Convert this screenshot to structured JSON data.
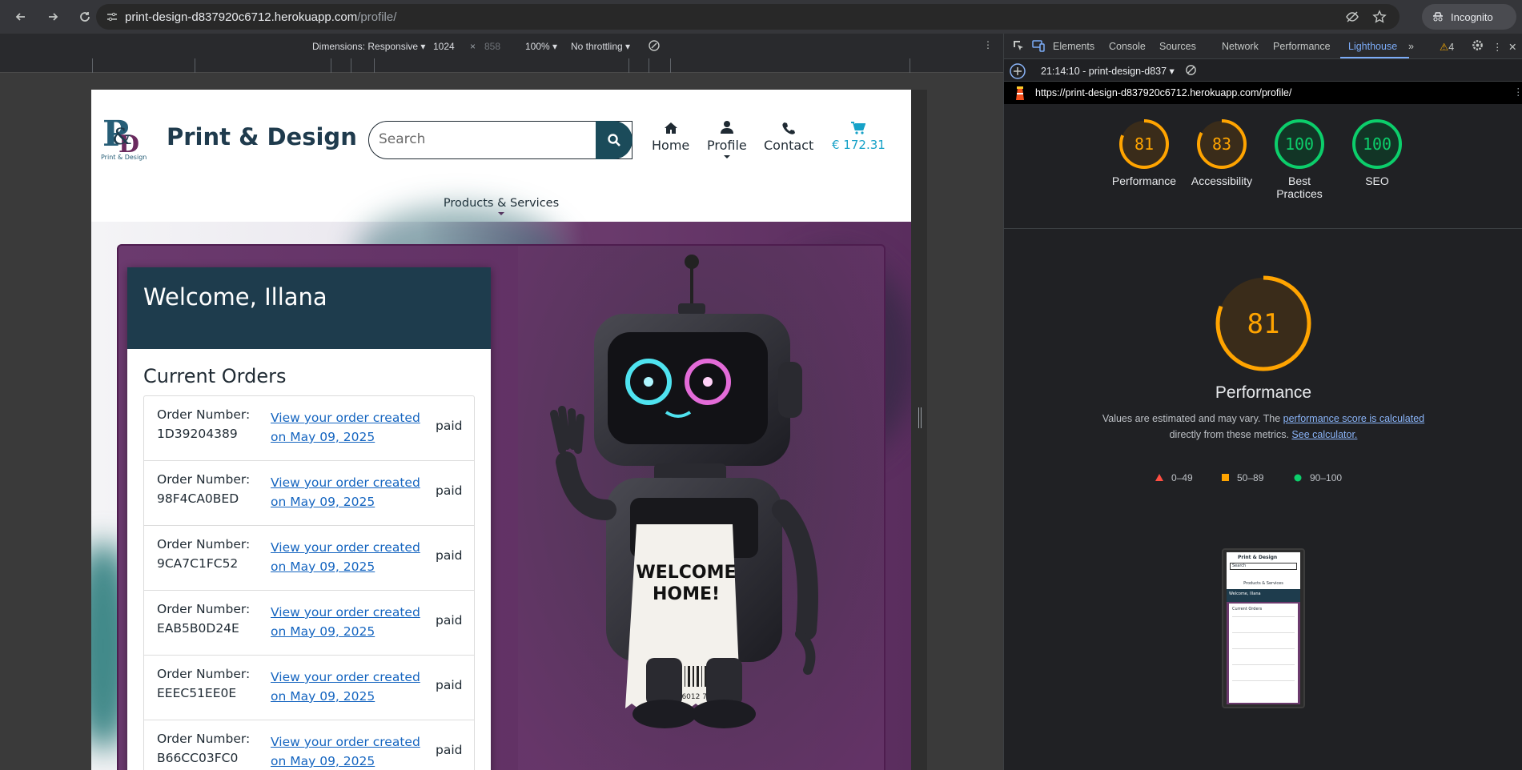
{
  "browser": {
    "url_host": "print-design-d837920c6712.herokuapp.com",
    "url_path": "/profile/",
    "incognito_label": "Incognito"
  },
  "device_toolbar": {
    "dimensions_label": "Dimensions: Responsive",
    "width": "1024",
    "times": "×",
    "height": "858",
    "zoom": "100%",
    "throttling": "No throttling"
  },
  "site": {
    "brand": "Print & Design",
    "logo_tagline": "Print & Design",
    "search_placeholder": "Search",
    "nav": {
      "home": "Home",
      "profile": "Profile",
      "contact": "Contact",
      "cart_total": "€ 172.31"
    },
    "subnav": "Products & Services",
    "welcome": "Welcome, Illana",
    "orders_title": "Current Orders",
    "orders": [
      {
        "label": "Order Number:",
        "number": "1D39204389",
        "link": "View your order created on May 09, 2025",
        "status": "paid"
      },
      {
        "label": "Order Number:",
        "number": "98F4CA0BED",
        "link": "View your order created on May 09, 2025",
        "status": "paid"
      },
      {
        "label": "Order Number:",
        "number": "9CA7C1FC52",
        "link": "View your order created on May 09, 2025",
        "status": "paid"
      },
      {
        "label": "Order Number:",
        "number": "EAB5B0D24E",
        "link": "View your order created on May 09, 2025",
        "status": "paid"
      },
      {
        "label": "Order Number:",
        "number": "EEEC51EE0E",
        "link": "View your order created on May 09, 2025",
        "status": "paid"
      },
      {
        "label": "Order Number:",
        "number": "B66CC03FC0",
        "link": "View your order created on May 09, 2025",
        "status": "paid"
      }
    ],
    "robot_receipt": {
      "line1": "WELCOME",
      "line2": "HOME!",
      "barcode_digits": "16-6 9 6012 781"
    }
  },
  "devtools": {
    "tabs": [
      "Elements",
      "Console",
      "Sources",
      "Network",
      "Performance",
      "Lighthouse"
    ],
    "active_tab": "Lighthouse",
    "warning_count": "4",
    "report_label": "21:14:10 - print-design-d837",
    "report_url": "https://print-design-d837920c6712.herokuapp.com/profile/",
    "scores": [
      {
        "label": "Performance",
        "value": "81",
        "color": "#ffa400"
      },
      {
        "label": "Accessibility",
        "value": "83",
        "color": "#ffa400"
      },
      {
        "label": "Best Practices",
        "value": "100",
        "color": "#0cce6b"
      },
      {
        "label": "SEO",
        "value": "100",
        "color": "#0cce6b"
      }
    ],
    "big_score": "81",
    "big_title": "Performance",
    "note_prefix": "Values are estimated and may vary. The ",
    "note_link1": "performance score is calculated",
    "note_middle": "directly from these metrics. ",
    "note_link2": "See calculator.",
    "legend": {
      "red": "0–49",
      "orange": "50–89",
      "green": "90–100"
    },
    "thumbnail": {
      "brand": "Print & Design",
      "search": "Search",
      "subnav": "Products & Services",
      "welcome": "Welcome, Illana",
      "orders_title": "Current Orders"
    }
  }
}
